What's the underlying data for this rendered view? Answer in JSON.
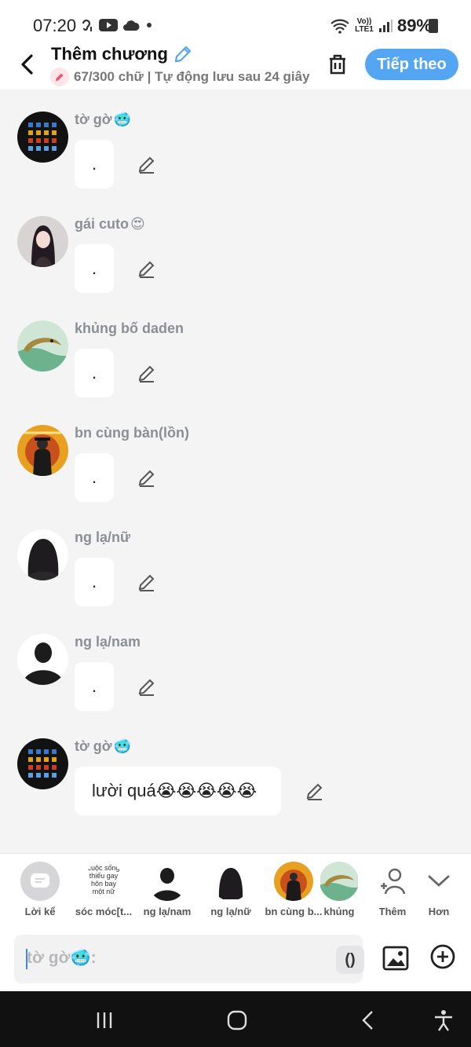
{
  "status_bar": {
    "time": "07:20",
    "battery": "89%",
    "network": "Vo)) LTE1"
  },
  "header": {
    "title": "Thêm chương",
    "subtitle": "67/300 chữ | Tự động lưu sau 24 giây",
    "next_label": "Tiếp theo",
    "accent_color": "#54a5f2"
  },
  "messages": [
    {
      "name": "tờ gờ",
      "emoji": "🥶",
      "text": "."
    },
    {
      "name": "gái cuto",
      "emoji": "😍",
      "text": "."
    },
    {
      "name": "khủng bố daden",
      "emoji": "",
      "text": "."
    },
    {
      "name": "bn cùng bàn(lồn)",
      "emoji": "",
      "text": "."
    },
    {
      "name": "ng lạ/nữ",
      "emoji": "",
      "text": "."
    },
    {
      "name": "ng lạ/nam",
      "emoji": "",
      "text": "."
    },
    {
      "name": "tờ gờ",
      "emoji": "🥶",
      "text": "lười quá😭😭😭😭😭"
    }
  ],
  "characters": [
    {
      "label": "Lời kể",
      "icon": "narration-icon"
    },
    {
      "label": "sóc móc[t...",
      "thumb_text": "cuộc sống thiếu gay hôn bay một nữ"
    },
    {
      "label": "ng lạ/nam"
    },
    {
      "label": "ng lạ/nữ"
    },
    {
      "label": "bn cùng b..."
    },
    {
      "label": "khủng"
    },
    {
      "label": "Thêm",
      "icon": "add-person-icon"
    },
    {
      "label": "Hơn",
      "icon": "chevron-down-icon"
    }
  ],
  "input": {
    "placeholder_name": "tờ gờ",
    "placeholder_emoji": "🥶",
    "placeholder_suffix": ":",
    "paren_label": "()"
  }
}
